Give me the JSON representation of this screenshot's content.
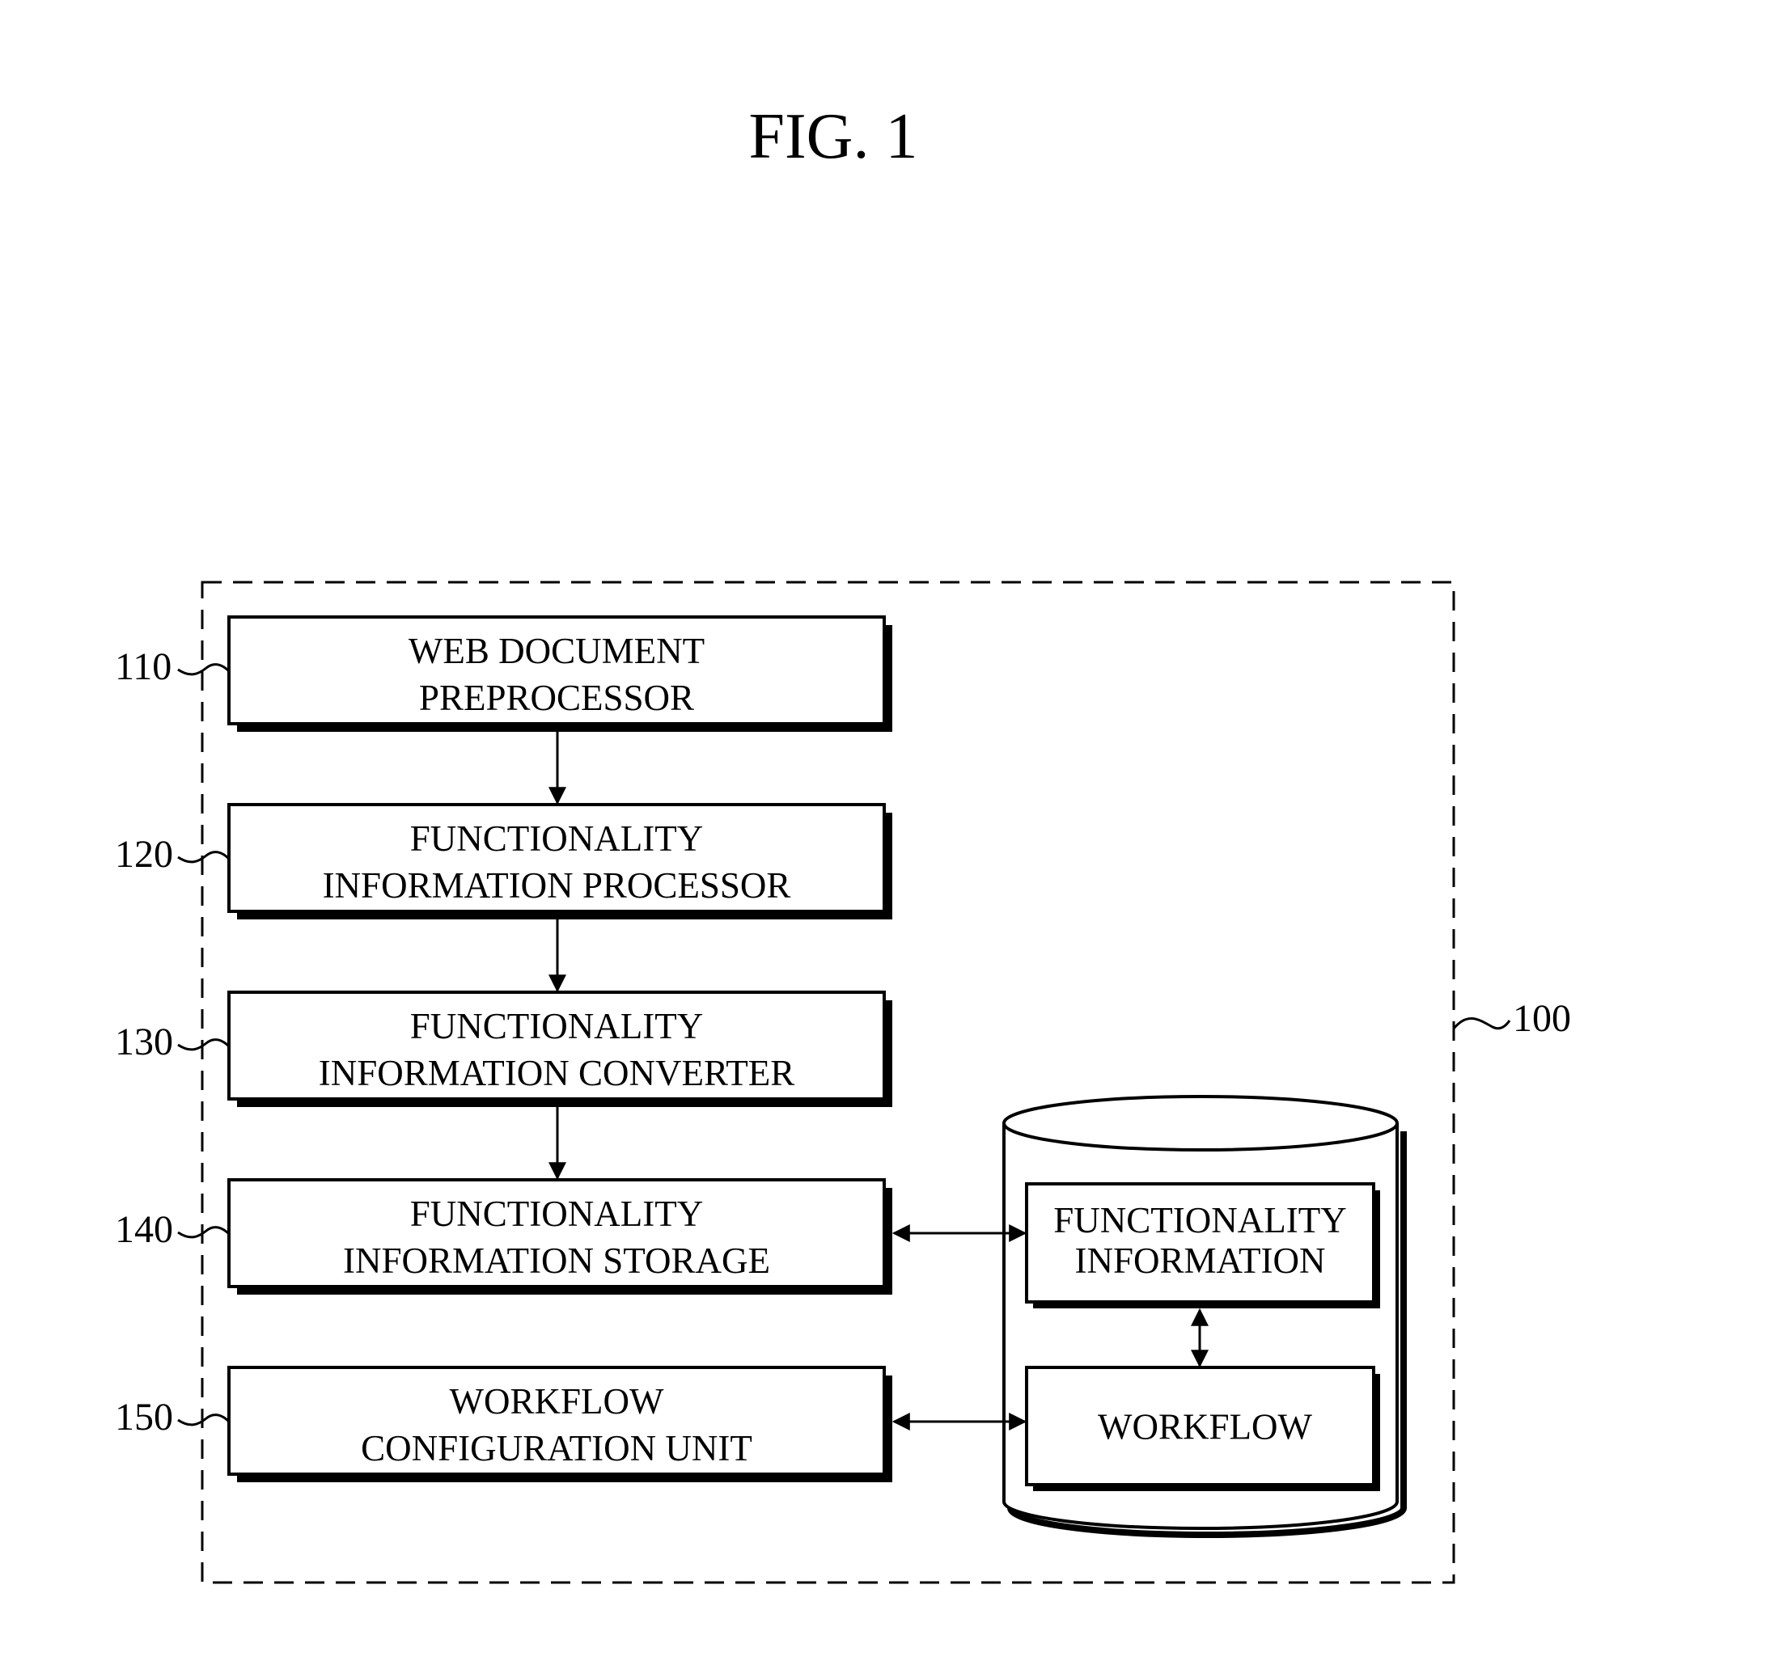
{
  "figure": {
    "title": "FIG. 1",
    "system_label": "100"
  },
  "blocks": [
    {
      "ref": "110",
      "lines": [
        "WEB DOCUMENT",
        "PREPROCESSOR"
      ]
    },
    {
      "ref": "120",
      "lines": [
        "FUNCTIONALITY",
        "INFORMATION PROCESSOR"
      ]
    },
    {
      "ref": "130",
      "lines": [
        "FUNCTIONALITY",
        "INFORMATION CONVERTER"
      ]
    },
    {
      "ref": "140",
      "lines": [
        "FUNCTIONALITY",
        "INFORMATION STORAGE"
      ]
    },
    {
      "ref": "150",
      "lines": [
        "WORKFLOW",
        "CONFIGURATION UNIT"
      ]
    }
  ],
  "database": {
    "items": [
      {
        "lines": [
          "FUNCTIONALITY",
          "INFORMATION"
        ]
      },
      {
        "lines": [
          "WORKFLOW"
        ]
      }
    ]
  },
  "connections": [
    {
      "from": "110",
      "to": "120",
      "type": "one-way"
    },
    {
      "from": "120",
      "to": "130",
      "type": "one-way"
    },
    {
      "from": "130",
      "to": "140",
      "type": "one-way"
    },
    {
      "from": "140",
      "to": "database.functionality-information",
      "type": "two-way"
    },
    {
      "from": "150",
      "to": "database.workflow",
      "type": "two-way"
    },
    {
      "from": "database.functionality-information",
      "to": "database.workflow",
      "type": "two-way"
    }
  ]
}
